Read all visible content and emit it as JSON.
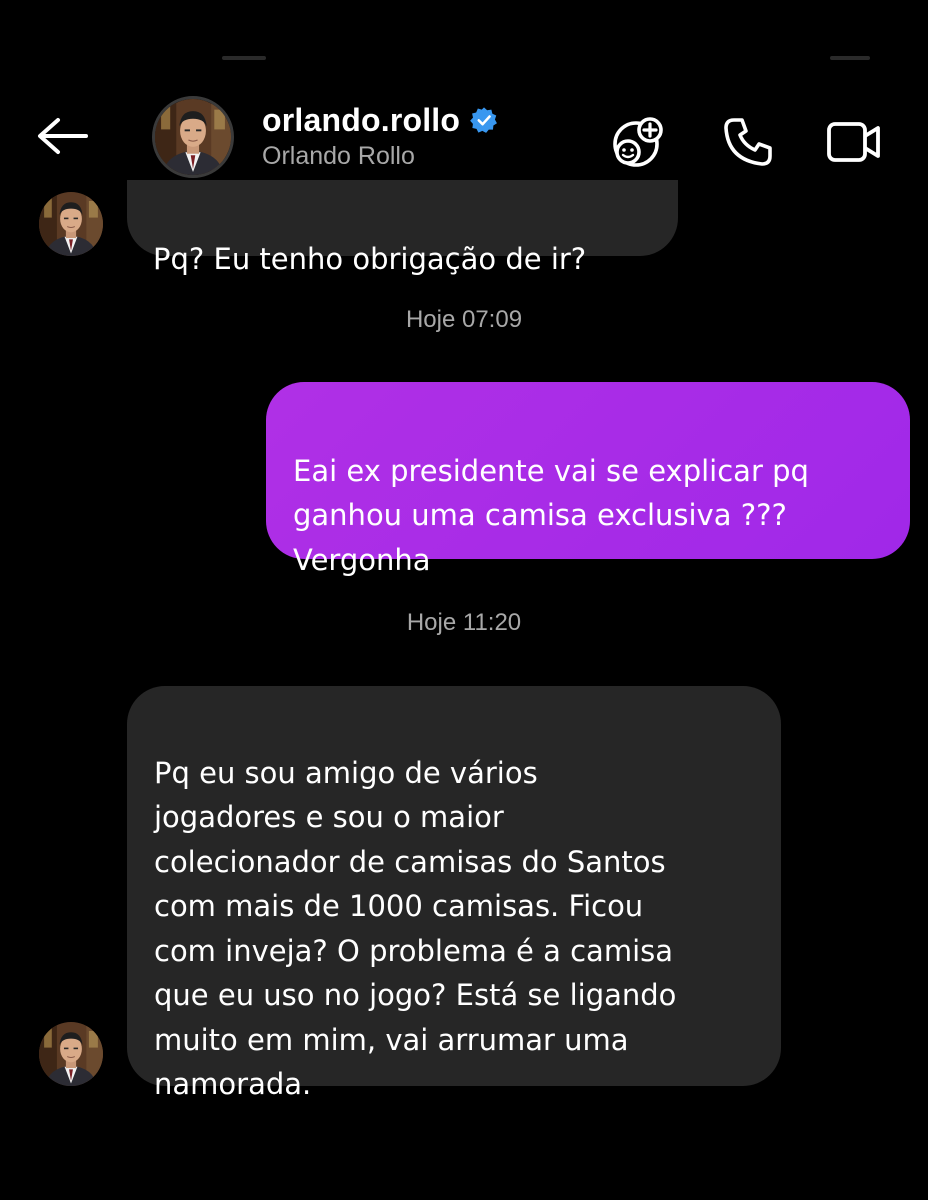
{
  "header": {
    "username": "orlando.rollo",
    "display_name": "Orlando Rollo",
    "verified": true,
    "icons": {
      "back": "back-arrow-icon",
      "effects": "effects-smiley-plus-icon",
      "call": "phone-icon",
      "video": "video-camera-icon",
      "verified": "verified-badge-icon"
    }
  },
  "messages": [
    {
      "sender": "other",
      "text": "Pq? Eu tenho obrigação de ir?"
    },
    {
      "type": "timestamp",
      "text": "Hoje 07:09"
    },
    {
      "sender": "me",
      "text": "Eai ex presidente vai se explicar pq\nganhou uma camisa exclusiva ???\nVergonha"
    },
    {
      "type": "timestamp",
      "text": "Hoje 11:20"
    },
    {
      "sender": "other",
      "text": "Pq eu sou amigo de vários\njogadores e sou o maior\ncolecionador de camisas do Santos\ncom mais de 1000 camisas. Ficou\ncom inveja? O problema é a camisa\nque eu uso no jogo? Está se ligando\nmuito em mim, vai arrumar uma\nnamorada."
    }
  ],
  "colors": {
    "background": "#000000",
    "incoming_bubble": "#262626",
    "outgoing_bubble": "#a52be4",
    "verified_badge": "#3897f0",
    "secondary_text": "#a8a8a8"
  }
}
